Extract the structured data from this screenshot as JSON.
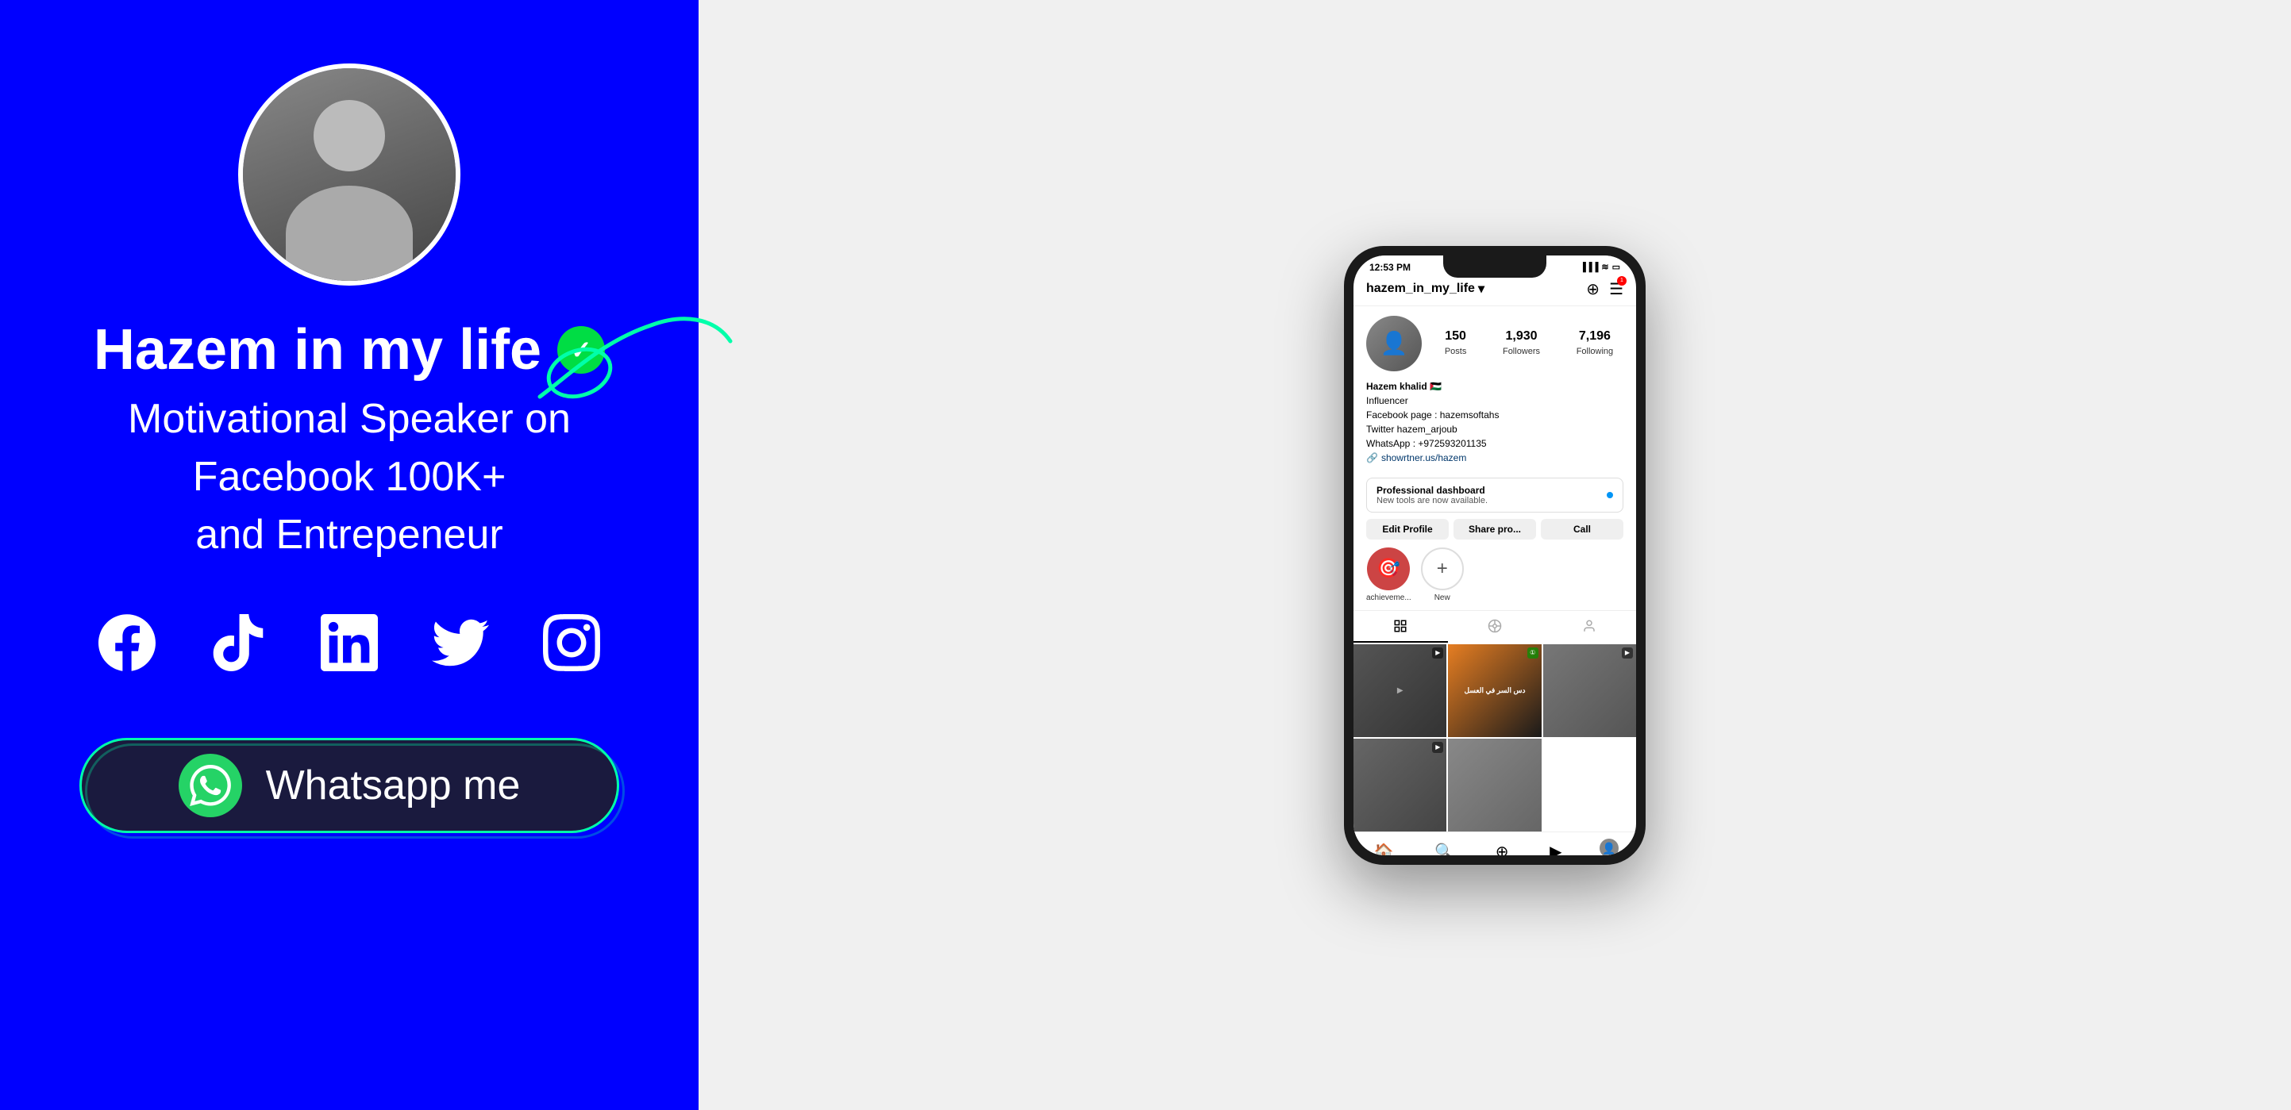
{
  "left": {
    "profile": {
      "name": "Hazem in my life",
      "subtitle_line1": "Motivational Speaker on Facebook 100K+",
      "subtitle_line2": "and Entrepeneur",
      "whatsapp_button": "Whatsapp me"
    },
    "social_icons": [
      "facebook",
      "tiktok",
      "linkedin",
      "twitter",
      "instagram"
    ]
  },
  "phone": {
    "status_bar": {
      "time": "12:53 PM",
      "icons": "signal wifi battery"
    },
    "header": {
      "username": "hazem_in_my_life",
      "dropdown_icon": "▾",
      "add_icon": "+",
      "menu_icon": "☰"
    },
    "stats": {
      "posts_count": "150",
      "posts_label": "Posts",
      "followers_count": "1,930",
      "followers_label": "Followers",
      "following_count": "7,196",
      "following_label": "Following"
    },
    "bio": {
      "name": "Hazem khalid 🇵🇸",
      "role": "Influencer",
      "facebook": "Facebook page : hazemsoftahs",
      "twitter": "Twitter hazem_arjoub",
      "whatsapp": "WhatsApp : +972593201135",
      "link": "showrtner.us/hazem"
    },
    "dashboard": {
      "title": "Professional dashboard",
      "subtitle": "New tools are now available."
    },
    "buttons": {
      "edit_profile": "Edit Profile",
      "share_profile": "Share pro...",
      "call": "Call"
    },
    "highlights": [
      {
        "label": "achieveme...",
        "has_image": true
      },
      {
        "label": "New",
        "is_add": true
      }
    ],
    "tabs": [
      "grid",
      "reels",
      "tagged"
    ],
    "posts": [
      {
        "id": 1,
        "has_overlay": true
      },
      {
        "id": 2,
        "has_overlay": true,
        "text": "دس السر في العسل"
      },
      {
        "id": 3,
        "has_overlay": true
      },
      {
        "id": 4,
        "has_overlay": false
      },
      {
        "id": 5,
        "has_overlay": false
      }
    ]
  }
}
